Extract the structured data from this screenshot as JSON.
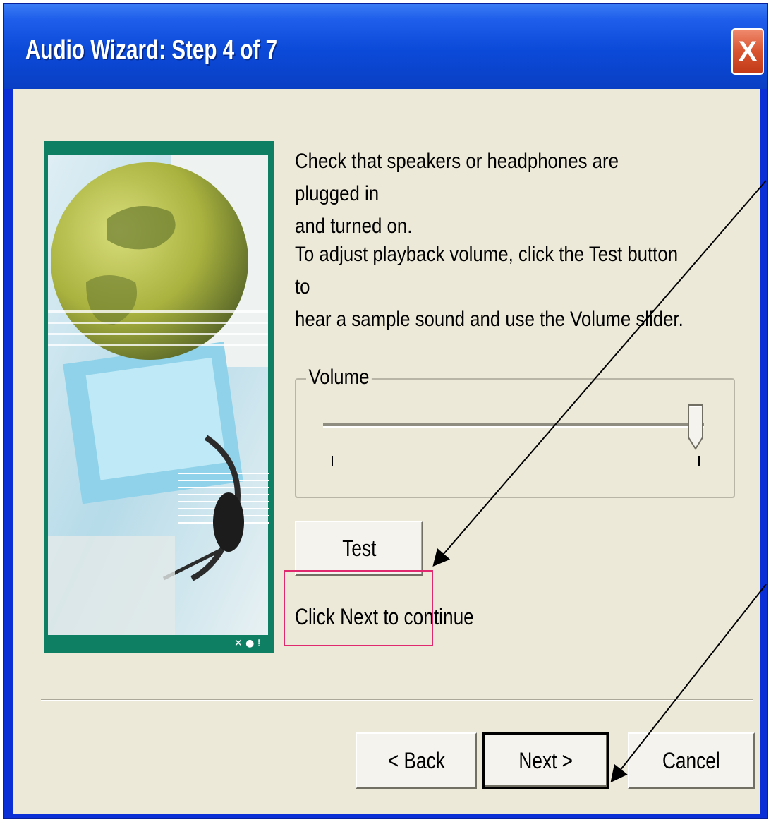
{
  "window": {
    "title": "Audio Wizard: Step 4 of 7",
    "close_glyph": "X"
  },
  "instructions": {
    "line1a": "Check that speakers or headphones are plugged in",
    "line1b": "and turned on.",
    "line2a": "To adjust playback volume, click the Test button to",
    "line2b": "hear a sample sound and use the Volume slider."
  },
  "volume": {
    "label": "Volume",
    "level_fraction": 1.0
  },
  "buttons": {
    "test": "Test",
    "back": "< Back",
    "next": "Next >",
    "cancel": "Cancel"
  },
  "continue_text": "Click Next to continue",
  "colors": {
    "titlebar": "#0b4ad8",
    "dialog_bg": "#ece9d8",
    "close_button": "#d8542f",
    "highlight_box": "#e0286e"
  },
  "icons": {
    "close": "close-icon",
    "wizard_picture": "globe-headset-illustration"
  }
}
